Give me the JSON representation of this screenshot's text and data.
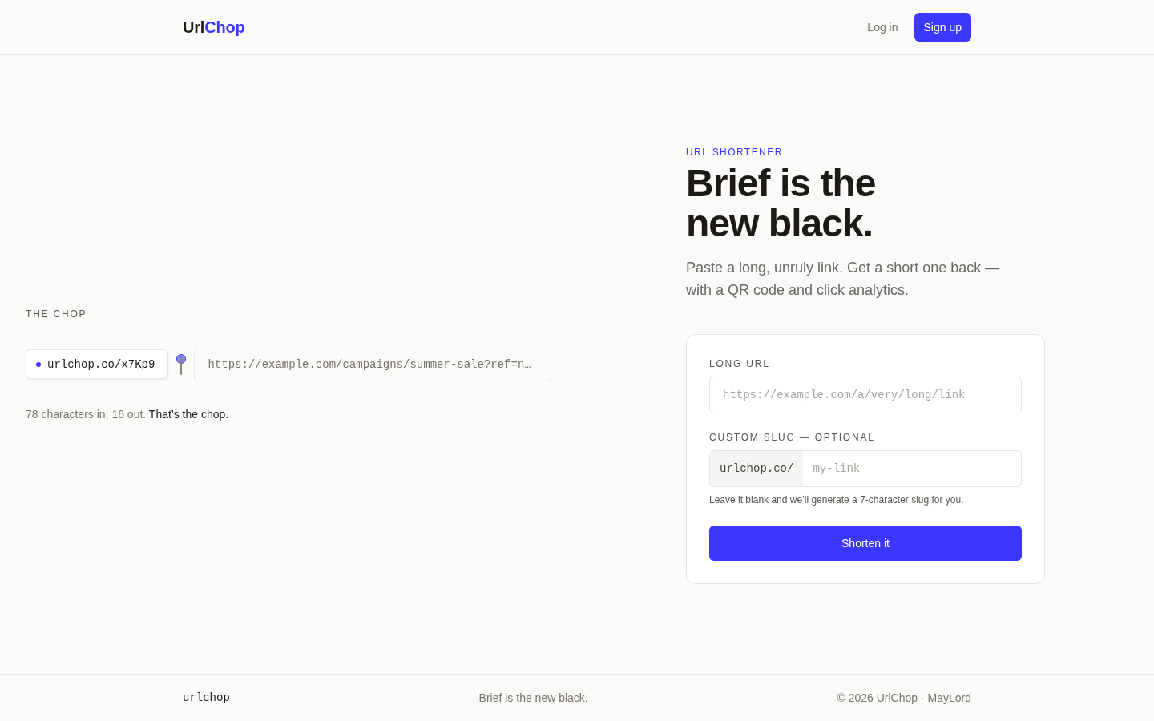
{
  "header": {
    "logo": {
      "text": "Url",
      "accent": "Chop"
    },
    "nav": [
      {
        "kind": "link",
        "label": "Log in"
      },
      {
        "kind": "button",
        "label": "Sign up"
      }
    ]
  },
  "demo": {
    "heading": "THE CHOP",
    "short_link": "urlchop.co/x7Kp9",
    "long_link": "https://example.com/campaigns/summer-sale?ref=n…",
    "caption": "78 characters in, 16 out.",
    "caption_emphasis": "That’s the chop."
  },
  "hero": {
    "eyebrow": "URL SHORTENER",
    "headline_lines": [
      "Brief is the",
      "new black."
    ],
    "subtitle": "Paste a long, unruly link. Get a short one back — with a QR code and click analytics."
  },
  "form": {
    "long_url": {
      "label": "LONG URL",
      "placeholder": "https://example.com/a/very/long/link"
    },
    "slug": {
      "label": "CUSTOM SLUG — OPTIONAL",
      "prefix": "urlchop.co/",
      "placeholder": "my-link",
      "hint": "Leave it blank and we’ll generate a 7-character slug for you."
    },
    "submit": "Shorten it"
  },
  "footer": {
    "wordmark": "urlchop",
    "tagline": "Brief is the new black.",
    "copyright": "© 2026 UrlChop · MayLord"
  }
}
